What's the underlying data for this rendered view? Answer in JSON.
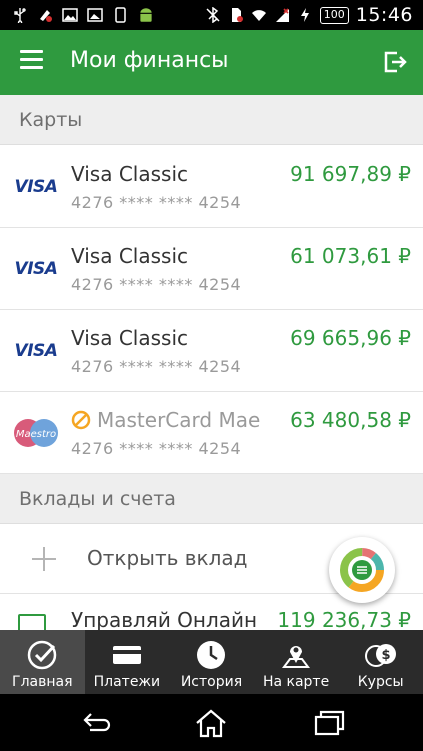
{
  "status_bar": {
    "time": "15:46",
    "battery": "100",
    "left_icons": [
      "usb-icon",
      "debug-icon",
      "image-icon",
      "gallery-icon",
      "phone-icon",
      "android-icon"
    ],
    "right_icons": [
      "bluetooth-off-icon",
      "sim-icon",
      "wifi-icon",
      "signal-icon",
      "charging-icon"
    ]
  },
  "toolbar": {
    "title": "Мои финансы",
    "menu_icon": "hamburger-menu-icon",
    "logout_icon": "logout-icon"
  },
  "sections": {
    "cards": "Карты",
    "deposits": "Вклады и счета"
  },
  "cards": [
    {
      "brand": "VISA",
      "name": "Visa Classic",
      "number": "4276 **** **** 4254",
      "amount": "91 697,89 ₽"
    },
    {
      "brand": "VISA",
      "name": "Visa Classic",
      "number": "4276 **** **** 4254",
      "amount": "61 073,61 ₽"
    },
    {
      "brand": "VISA",
      "name": "Visa Classic",
      "number": "4276 **** **** 4254",
      "amount": "69 665,96 ₽"
    },
    {
      "brand": "Maestro",
      "name": "MasterCard Mae",
      "number": "4276 **** **** 4254",
      "amount": "63 480,58 ₽",
      "blocked_icon": "blocked-icon"
    }
  ],
  "deposit": {
    "open_label": "Открыть вклад",
    "account_name": "Управляй Онлайн",
    "account_amount": "119 236,73 ₽"
  },
  "fab": {
    "icon": "finance-chart-icon"
  },
  "bottom_nav": [
    {
      "label": "Главная",
      "icon": "sberbank-logo-icon",
      "active": true
    },
    {
      "label": "Платежи",
      "icon": "payment-card-icon",
      "active": false
    },
    {
      "label": "История",
      "icon": "clock-icon",
      "active": false
    },
    {
      "label": "На карте",
      "icon": "map-pin-icon",
      "active": false
    },
    {
      "label": "Курсы",
      "icon": "currency-icon",
      "active": false
    }
  ],
  "colors": {
    "brand_green": "#2f9a3f",
    "amount_green": "#2f9a3f",
    "section_bg": "#eeeeee",
    "nav_bg": "#2b2b2b"
  }
}
